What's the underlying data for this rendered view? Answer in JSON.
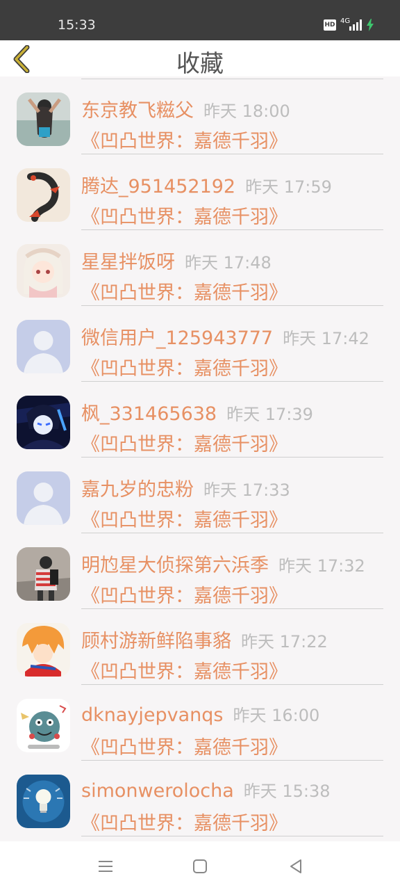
{
  "status_bar": {
    "time": "15:33",
    "hd_badge": "HD",
    "network": "4G",
    "icons": [
      "hd-icon",
      "signal-icon",
      "battery-charging-icon"
    ]
  },
  "header": {
    "title": "收藏",
    "back_icon": "chevron-left-icon",
    "accent_color": "#c9b037"
  },
  "items": [
    {
      "name": "东京教飞糍父",
      "time": "昨天 18:00",
      "work": "《凹凸世界：嘉德千羽》",
      "avatar": "photo"
    },
    {
      "name": "腾达_951452192",
      "time": "昨天 17:59",
      "work": "《凹凸世界：嘉德千羽》",
      "avatar": "koi"
    },
    {
      "name": "星星拌饭呀",
      "time": "昨天 17:48",
      "work": "《凹凸世界：嘉德千羽》",
      "avatar": "anime-girl"
    },
    {
      "name": "微信用户_125943777",
      "time": "昨天 17:42",
      "work": "《凹凸世界：嘉德千羽》",
      "avatar": "default"
    },
    {
      "name": "枫_331465638",
      "time": "昨天 17:39",
      "work": "《凹凸世界：嘉德千羽》",
      "avatar": "dark-anime"
    },
    {
      "name": "嘉九岁的忠粉",
      "time": "昨天 17:33",
      "work": "《凹凸世界：嘉德千羽》",
      "avatar": "default"
    },
    {
      "name": "明尥星大侦探第六浜季",
      "time": "昨天 17:32",
      "work": "《凹凸世界：嘉德千羽》",
      "avatar": "person"
    },
    {
      "name": "顾村游新鲜陷事貉",
      "time": "昨天 17:22",
      "work": "《凹凸世界：嘉德千羽》",
      "avatar": "orange-hair"
    },
    {
      "name": "dknayjepvanqs",
      "time": "昨天 16:00",
      "work": "《凹凸世界：嘉德千羽》",
      "avatar": "cartoon"
    },
    {
      "name": "simonwerolocha",
      "time": "昨天 15:38",
      "work": "《凹凸世界：嘉德千羽》",
      "avatar": "bulb"
    }
  ],
  "colors": {
    "name": "#e79063",
    "time": "#bdbdbd",
    "background": "#f7f5f6"
  },
  "nav_bar": {
    "icons": [
      "menu-icon",
      "home-icon",
      "back-icon"
    ]
  }
}
